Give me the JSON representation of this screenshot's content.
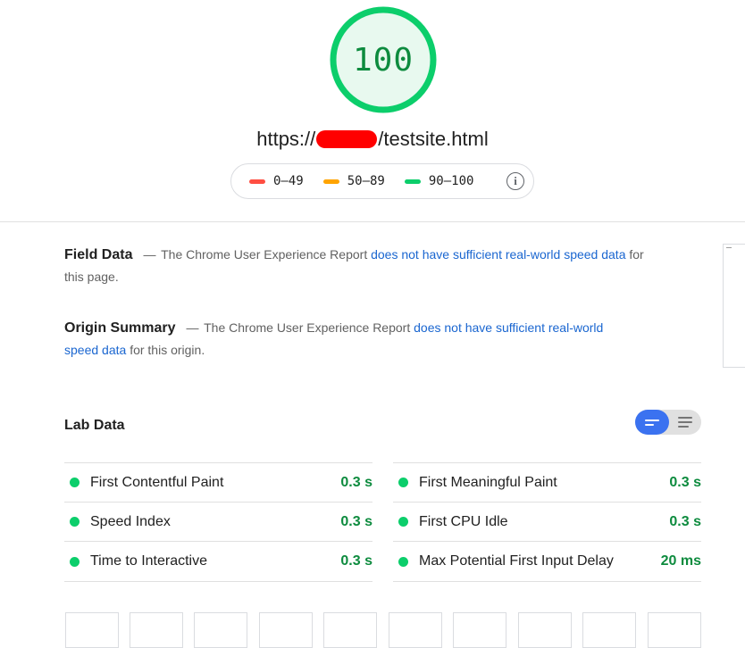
{
  "score": {
    "value": "100",
    "ring_color": "#0cce6b",
    "fill_color": "#e8f9ef",
    "text_color": "#0d8b3e"
  },
  "url": {
    "prefix": "https://",
    "suffix": "/testsite.html"
  },
  "legend": {
    "items": [
      {
        "range": "0–49",
        "color": "#ff4e42"
      },
      {
        "range": "50–89",
        "color": "#ffa400"
      },
      {
        "range": "90–100",
        "color": "#0cce6b"
      }
    ],
    "info_icon": "info-icon"
  },
  "field_data": {
    "title": "Field Data",
    "dash": "—",
    "text_before": "The Chrome User Experience Report",
    "link": "does not have sufficient real-world speed data",
    "text_after": "for this page."
  },
  "origin_summary": {
    "title": "Origin Summary",
    "dash": "—",
    "text_before": "The Chrome User Experience Report",
    "link": "does not have sufficient real-world speed data",
    "text_after": "for this origin."
  },
  "lab_data": {
    "title": "Lab Data",
    "toggle": {
      "active": "compact-view-icon",
      "inactive": "expanded-view-icon",
      "active_color": "#3b72f0"
    },
    "metrics_left": [
      {
        "label": "First Contentful Paint",
        "value": "0.3 s"
      },
      {
        "label": "Speed Index",
        "value": "0.3 s"
      },
      {
        "label": "Time to Interactive",
        "value": "0.3 s"
      }
    ],
    "metrics_right": [
      {
        "label": "First Meaningful Paint",
        "value": "0.3 s"
      },
      {
        "label": "First CPU Idle",
        "value": "0.3 s"
      },
      {
        "label": "Max Potential First Input Delay",
        "value": "20 ms"
      }
    ]
  }
}
